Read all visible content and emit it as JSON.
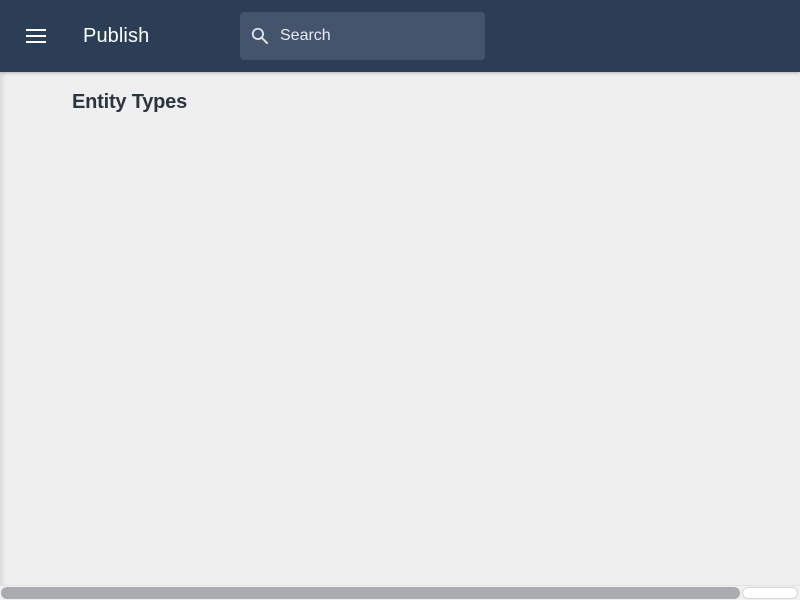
{
  "header": {
    "menu_icon": "hamburger-menu-icon",
    "title": "Publish",
    "search": {
      "icon": "search-icon",
      "placeholder": "Search",
      "value": ""
    }
  },
  "main": {
    "title": "Entity Types"
  },
  "colors": {
    "header_bg": "#2c3e55",
    "search_bg": "#44546c",
    "page_bg": "#efefef",
    "title_text": "#2b3440",
    "scrollbar_thumb": "#a9abae"
  }
}
